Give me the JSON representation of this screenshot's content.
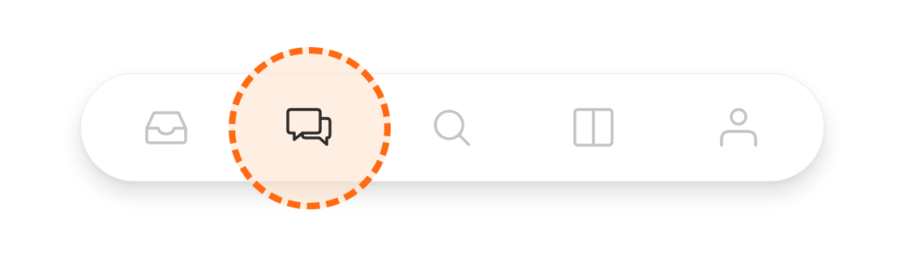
{
  "tabbar": {
    "items": [
      {
        "id": "inbox",
        "icon": "inbox-icon",
        "active": false
      },
      {
        "id": "messages",
        "icon": "chat-bubbles-icon",
        "active": true
      },
      {
        "id": "search",
        "icon": "search-icon",
        "active": false
      },
      {
        "id": "split-view",
        "icon": "split-view-icon",
        "active": false
      },
      {
        "id": "profile",
        "icon": "user-icon",
        "active": false
      }
    ]
  },
  "highlight": {
    "target": "messages",
    "ring_color": "#ff6a13",
    "fill_color": "#ffe4d0"
  },
  "colors": {
    "icon_inactive": "#c4c4c4",
    "icon_active": "#2b2b2b",
    "bar_background": "#ffffff"
  }
}
